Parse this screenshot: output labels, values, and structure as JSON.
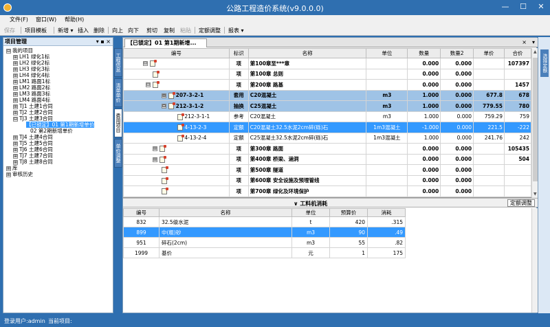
{
  "window": {
    "title": "公路工程造价系统(v9.0.0.0)",
    "controls": [
      "—",
      "☐",
      "✕"
    ]
  },
  "menu": [
    "文件(F)",
    "窗口(W)",
    "帮助(H)"
  ],
  "toolbar": {
    "save": "保存",
    "template": "项目模板",
    "add": "新增 ▾",
    "insert": "插入",
    "delete": "删除",
    "up": "向上",
    "down": "向下",
    "cut": "剪切",
    "copy": "复制",
    "paste": "粘贴",
    "quota_adjust": "定额调整",
    "report": "报表 ▾"
  },
  "left_panel": {
    "title": "项目管理",
    "title_tools": "▾ ▪ ×",
    "tree": [
      {
        "pm": "⊟",
        "label": "我的项目"
      },
      {
        "pm": "⊞",
        "label": "LH1 绿化1标"
      },
      {
        "pm": "⊞",
        "label": "LH2 绿化2标"
      },
      {
        "pm": "⊞",
        "label": "LH3 绿化3标"
      },
      {
        "pm": "⊞",
        "label": "LH4 绿化4标"
      },
      {
        "pm": "⊞",
        "label": "LM1 路面1标"
      },
      {
        "pm": "⊞",
        "label": "LM2 路面2标"
      },
      {
        "pm": "⊞",
        "label": "LM3 路面3标"
      },
      {
        "pm": "⊞",
        "label": "LM4 路面4标"
      },
      {
        "pm": "⊞",
        "label": "TJ1 土建1合同"
      },
      {
        "pm": "⊞",
        "label": "TJ2 土建2合同"
      },
      {
        "pm": "⊟",
        "label": "TJ3 土建3合同"
      },
      {
        "pm": "",
        "label": "【已锁定】01 第1期新增单价"
      },
      {
        "pm": "",
        "label": "02 第2期新增单价"
      },
      {
        "pm": "⊞",
        "label": "TJ4 土建4合同"
      },
      {
        "pm": "⊞",
        "label": "TJ5 土建5合同"
      },
      {
        "pm": "⊞",
        "label": "TJ6 土建6合同"
      },
      {
        "pm": "⊞",
        "label": "TJ7 土建7合同"
      },
      {
        "pm": "⊞",
        "label": "TJ8 土建8合同"
      },
      {
        "pm": "⊞",
        "label": "库"
      },
      {
        "pm": "⊞",
        "label": "审核历史"
      }
    ]
  },
  "side_tabs": [
    "工程信息",
    "清单单价",
    "费用项目",
    "单价调整"
  ],
  "doc_tab": {
    "label": "【已锁定】01 第1期新增...",
    "close": "×",
    "menu": "▾"
  },
  "grid": {
    "columns": [
      "编号",
      "标识",
      "名称",
      "单位",
      "数量",
      "数量2",
      "单价",
      "合价"
    ],
    "rows": [
      {
        "expander": "⊟",
        "code": "",
        "flag": "项",
        "name": "第100章至***章",
        "unit": "",
        "qty": "0.000",
        "qty2": "0.000",
        "price": "",
        "total": "107397"
      },
      {
        "expander": "",
        "code": "",
        "flag": "项",
        "name": "第100章 总则",
        "unit": "",
        "qty": "0.000",
        "qty2": "0.000",
        "price": "",
        "total": ""
      },
      {
        "expander": "⊟",
        "code": "",
        "flag": "项",
        "name": "第200章 路基",
        "unit": "",
        "qty": "0.000",
        "qty2": "0.000",
        "price": "",
        "total": "1457"
      },
      {
        "expander": "⊞",
        "code": "207-3-2-1",
        "flag": "套用",
        "name": "C20混凝土",
        "unit": "m3",
        "qty": "1.000",
        "qty2": "0.000",
        "price": "677.8",
        "total": "678"
      },
      {
        "expander": "⊟",
        "code": "212-3-1-2",
        "flag": "抽换",
        "name": "C25混凝土",
        "unit": "m3",
        "qty": "1.000",
        "qty2": "0.000",
        "price": "779.55",
        "total": "780"
      },
      {
        "expander": "",
        "code": "212-3-1-1",
        "flag": "参考",
        "name": "C20混凝土",
        "unit": "m3",
        "qty": "1.000",
        "qty2": "0.000",
        "price": "759.29",
        "total": "759"
      },
      {
        "expander": "",
        "code": "4-13-2-3",
        "flag": "定额",
        "name": "C20混凝土32.5水泥2cm碎(砾)石",
        "unit": "1m3混凝土",
        "qty": "-1.000",
        "qty2": "0.000",
        "price": "221.5",
        "total": "-222"
      },
      {
        "expander": "",
        "code": "4-13-2-4",
        "flag": "定额",
        "name": "C25混凝土32.5水泥2cm碎(砾)石",
        "unit": "1m3混凝土",
        "qty": "1.000",
        "qty2": "0.000",
        "price": "241.76",
        "total": "242"
      },
      {
        "expander": "⊞",
        "code": "",
        "flag": "项",
        "name": "第300章 路面",
        "unit": "",
        "qty": "0.000",
        "qty2": "0.000",
        "price": "",
        "total": "105435"
      },
      {
        "expander": "⊞",
        "code": "",
        "flag": "项",
        "name": "第400章 桥梁、涵洞",
        "unit": "",
        "qty": "0.000",
        "qty2": "0.000",
        "price": "",
        "total": "504"
      },
      {
        "expander": "",
        "code": "",
        "flag": "项",
        "name": "第500章 隧道",
        "unit": "",
        "qty": "0.000",
        "qty2": "0.000",
        "price": "",
        "total": ""
      },
      {
        "expander": "",
        "code": "",
        "flag": "项",
        "name": "第600章 安全设施及预埋管线",
        "unit": "",
        "qty": "0.000",
        "qty2": "0.000",
        "price": "",
        "total": ""
      },
      {
        "expander": "",
        "code": "",
        "flag": "项",
        "name": "第700章 绿化及环境保护",
        "unit": "",
        "qty": "0.000",
        "qty2": "0.000",
        "price": "",
        "total": ""
      }
    ]
  },
  "lower_section": {
    "title": "∨  工料机消耗",
    "button": "定额调整",
    "columns": [
      "编号",
      "名称",
      "单位",
      "预算价",
      "消耗"
    ],
    "rows": [
      {
        "code": "832",
        "name": "32.5级水泥",
        "unit": "t",
        "price": "420",
        "consume": ".315"
      },
      {
        "code": "899",
        "name": "中(粗)砂",
        "unit": "m3",
        "price": "90",
        "consume": ".49"
      },
      {
        "code": "951",
        "name": "碎石(2cm)",
        "unit": "m3",
        "price": "55",
        "consume": ".82"
      },
      {
        "code": "1999",
        "name": "基价",
        "unit": "元",
        "price": "1",
        "consume": "175"
      }
    ]
  },
  "right_strip": {
    "label": "选择定额"
  },
  "status": {
    "user": "登录用户:admin",
    "project": "当前项目:"
  },
  "colors": {
    "title_bg": "#2f6fb0",
    "selected": "#3399ff",
    "highlight": "#9fc3e6"
  }
}
